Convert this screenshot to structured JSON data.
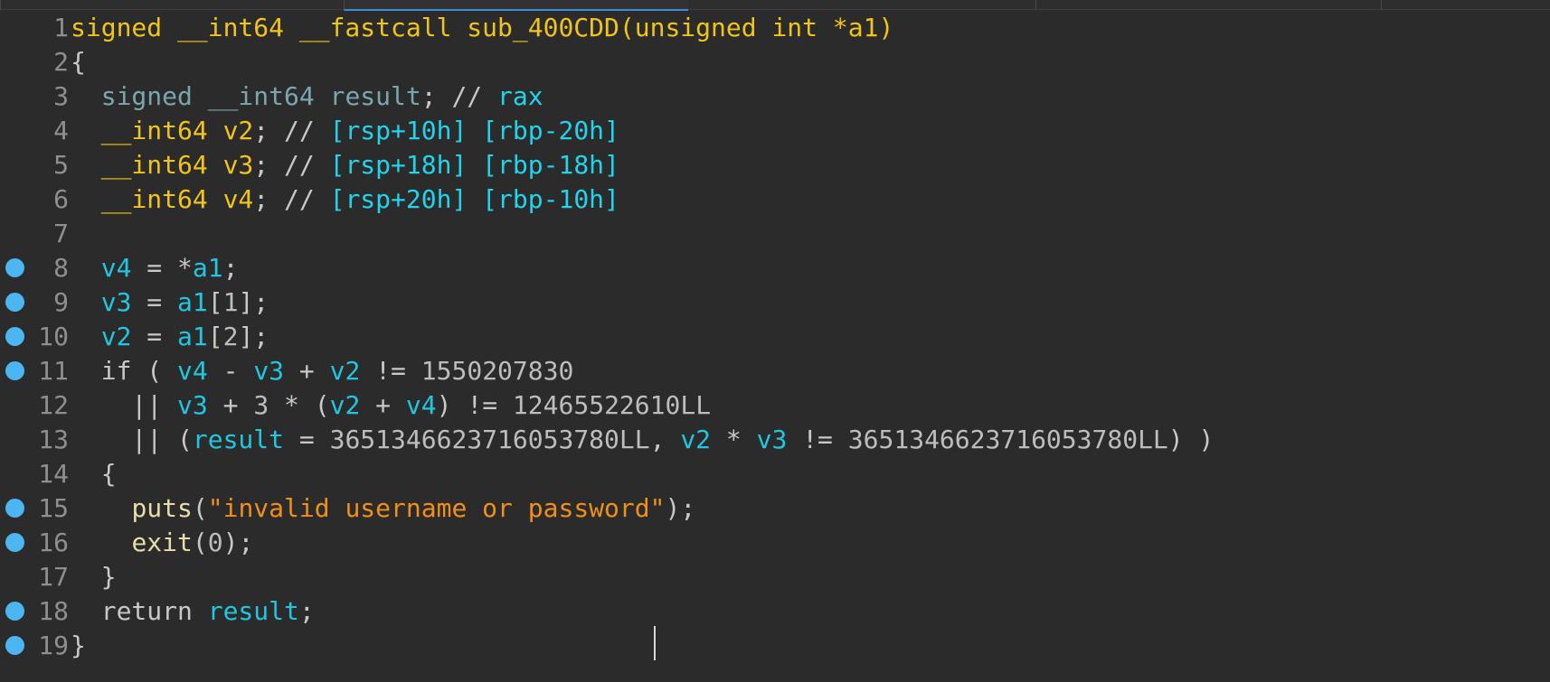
{
  "colors": {
    "background": "#2b2b2b",
    "line_number": "#8f8f8f",
    "default_text": "#c8c8c8",
    "type_keyword": "#f0c419",
    "variable": "#21c7e0",
    "string": "#f0901a",
    "breakpoint": "#4cb6f2",
    "tab_active_accent": "#3a8ed8"
  },
  "lines": [
    {
      "num": "1",
      "breakpoint": false,
      "tokens": [
        {
          "text": "signed __int64 __fastcall sub_400CDD(unsigned int *a1)",
          "cls": "t-type"
        }
      ]
    },
    {
      "num": "2",
      "breakpoint": false,
      "tokens": [
        {
          "text": "{",
          "cls": "t-default"
        }
      ]
    },
    {
      "num": "3",
      "breakpoint": false,
      "tokens": [
        {
          "text": "  ",
          "cls": "t-default"
        },
        {
          "text": "signed __int64 result",
          "cls": "t-dimtype"
        },
        {
          "text": "; // ",
          "cls": "t-cmt"
        },
        {
          "text": "rax",
          "cls": "t-cmtval"
        }
      ]
    },
    {
      "num": "4",
      "breakpoint": false,
      "tokens": [
        {
          "text": "  ",
          "cls": "t-default"
        },
        {
          "text": "__int64 v2",
          "cls": "t-type"
        },
        {
          "text": "; // ",
          "cls": "t-cmt"
        },
        {
          "text": "[rsp+10h] [rbp-20h]",
          "cls": "t-cmtval"
        }
      ]
    },
    {
      "num": "5",
      "breakpoint": false,
      "tokens": [
        {
          "text": "  ",
          "cls": "t-default"
        },
        {
          "text": "__int64 v3",
          "cls": "t-type"
        },
        {
          "text": "; // ",
          "cls": "t-cmt"
        },
        {
          "text": "[rsp+18h] [rbp-18h]",
          "cls": "t-cmtval"
        }
      ]
    },
    {
      "num": "6",
      "breakpoint": false,
      "tokens": [
        {
          "text": "  ",
          "cls": "t-default"
        },
        {
          "text": "__int64 v4",
          "cls": "t-type"
        },
        {
          "text": "; // ",
          "cls": "t-cmt"
        },
        {
          "text": "[rsp+20h] [rbp-10h]",
          "cls": "t-cmtval"
        }
      ]
    },
    {
      "num": "7",
      "breakpoint": false,
      "tokens": []
    },
    {
      "num": "8",
      "breakpoint": true,
      "tokens": [
        {
          "text": "  ",
          "cls": "t-default"
        },
        {
          "text": "v4",
          "cls": "t-var"
        },
        {
          "text": " = *",
          "cls": "t-default"
        },
        {
          "text": "a1",
          "cls": "t-var"
        },
        {
          "text": ";",
          "cls": "t-default"
        }
      ]
    },
    {
      "num": "9",
      "breakpoint": true,
      "tokens": [
        {
          "text": "  ",
          "cls": "t-default"
        },
        {
          "text": "v3",
          "cls": "t-var"
        },
        {
          "text": " = ",
          "cls": "t-default"
        },
        {
          "text": "a1",
          "cls": "t-var"
        },
        {
          "text": "[",
          "cls": "t-default"
        },
        {
          "text": "1",
          "cls": "t-num"
        },
        {
          "text": "];",
          "cls": "t-default"
        }
      ]
    },
    {
      "num": "10",
      "breakpoint": true,
      "tokens": [
        {
          "text": "  ",
          "cls": "t-default"
        },
        {
          "text": "v2",
          "cls": "t-var"
        },
        {
          "text": " = ",
          "cls": "t-default"
        },
        {
          "text": "a1",
          "cls": "t-var"
        },
        {
          "text": "[",
          "cls": "t-default"
        },
        {
          "text": "2",
          "cls": "t-num"
        },
        {
          "text": "];",
          "cls": "t-default"
        }
      ]
    },
    {
      "num": "11",
      "breakpoint": true,
      "tokens": [
        {
          "text": "  if ( ",
          "cls": "t-kw"
        },
        {
          "text": "v4",
          "cls": "t-var"
        },
        {
          "text": " - ",
          "cls": "t-default"
        },
        {
          "text": "v3",
          "cls": "t-var"
        },
        {
          "text": " + ",
          "cls": "t-default"
        },
        {
          "text": "v2",
          "cls": "t-var"
        },
        {
          "text": " != ",
          "cls": "t-default"
        },
        {
          "text": "1550207830",
          "cls": "t-num"
        }
      ]
    },
    {
      "num": "12",
      "breakpoint": false,
      "tokens": [
        {
          "text": "    || ",
          "cls": "t-default"
        },
        {
          "text": "v3",
          "cls": "t-var"
        },
        {
          "text": " + ",
          "cls": "t-default"
        },
        {
          "text": "3",
          "cls": "t-num"
        },
        {
          "text": " * (",
          "cls": "t-default"
        },
        {
          "text": "v2",
          "cls": "t-var"
        },
        {
          "text": " + ",
          "cls": "t-default"
        },
        {
          "text": "v4",
          "cls": "t-var"
        },
        {
          "text": ") != ",
          "cls": "t-default"
        },
        {
          "text": "12465522610LL",
          "cls": "t-num"
        }
      ]
    },
    {
      "num": "13",
      "breakpoint": false,
      "tokens": [
        {
          "text": "    || (",
          "cls": "t-default"
        },
        {
          "text": "result",
          "cls": "t-var"
        },
        {
          "text": " = ",
          "cls": "t-default"
        },
        {
          "text": "3651346623716053780LL",
          "cls": "t-num"
        },
        {
          "text": ", ",
          "cls": "t-default"
        },
        {
          "text": "v2",
          "cls": "t-var"
        },
        {
          "text": " * ",
          "cls": "t-default"
        },
        {
          "text": "v3",
          "cls": "t-var"
        },
        {
          "text": " != ",
          "cls": "t-default"
        },
        {
          "text": "3651346623716053780LL",
          "cls": "t-num"
        },
        {
          "text": ") )",
          "cls": "t-default"
        }
      ]
    },
    {
      "num": "14",
      "breakpoint": false,
      "tokens": [
        {
          "text": "  {",
          "cls": "t-default"
        }
      ]
    },
    {
      "num": "15",
      "breakpoint": true,
      "tokens": [
        {
          "text": "    ",
          "cls": "t-default"
        },
        {
          "text": "puts",
          "cls": "t-local"
        },
        {
          "text": "(",
          "cls": "t-default"
        },
        {
          "text": "\"invalid username or password\"",
          "cls": "t-str"
        },
        {
          "text": ");",
          "cls": "t-default"
        }
      ]
    },
    {
      "num": "16",
      "breakpoint": true,
      "tokens": [
        {
          "text": "    ",
          "cls": "t-default"
        },
        {
          "text": "exit",
          "cls": "t-local"
        },
        {
          "text": "(",
          "cls": "t-default"
        },
        {
          "text": "0",
          "cls": "t-num"
        },
        {
          "text": ");",
          "cls": "t-default"
        }
      ]
    },
    {
      "num": "17",
      "breakpoint": false,
      "tokens": [
        {
          "text": "  }",
          "cls": "t-default"
        }
      ]
    },
    {
      "num": "18",
      "breakpoint": true,
      "tokens": [
        {
          "text": "  return ",
          "cls": "t-kw"
        },
        {
          "text": "result",
          "cls": "t-var"
        },
        {
          "text": ";",
          "cls": "t-default"
        }
      ]
    },
    {
      "num": "19",
      "breakpoint": true,
      "tokens": [
        {
          "text": "}",
          "cls": "t-default"
        }
      ]
    }
  ]
}
